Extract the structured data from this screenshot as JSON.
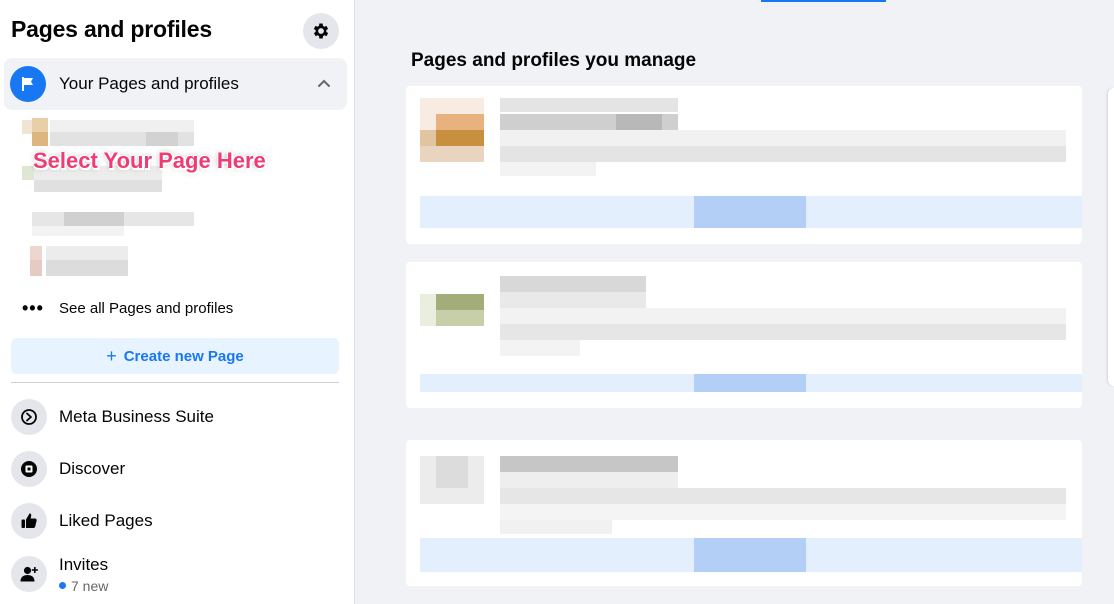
{
  "sidebar": {
    "title": "Pages and profiles",
    "settings_icon": "gear-icon",
    "section_label": "Your Pages and profiles",
    "annotation": "Select Your Page Here",
    "see_all_label": "See all Pages and profiles",
    "create_button_label": "Create new Page",
    "nav_items": [
      {
        "label": "Meta Business Suite",
        "icon": "business-suite-icon"
      },
      {
        "label": "Discover",
        "icon": "discover-icon"
      },
      {
        "label": "Liked Pages",
        "icon": "thumbs-up-icon"
      },
      {
        "label": "Invites",
        "icon": "add-person-icon",
        "sub": "7 new"
      }
    ]
  },
  "main": {
    "title": "Pages and profiles you manage"
  },
  "colors": {
    "accent": "#1877f2",
    "annotation": "#ee3d74",
    "button_bg": "#e7f3ff",
    "page_bg": "#f0f2f5"
  }
}
